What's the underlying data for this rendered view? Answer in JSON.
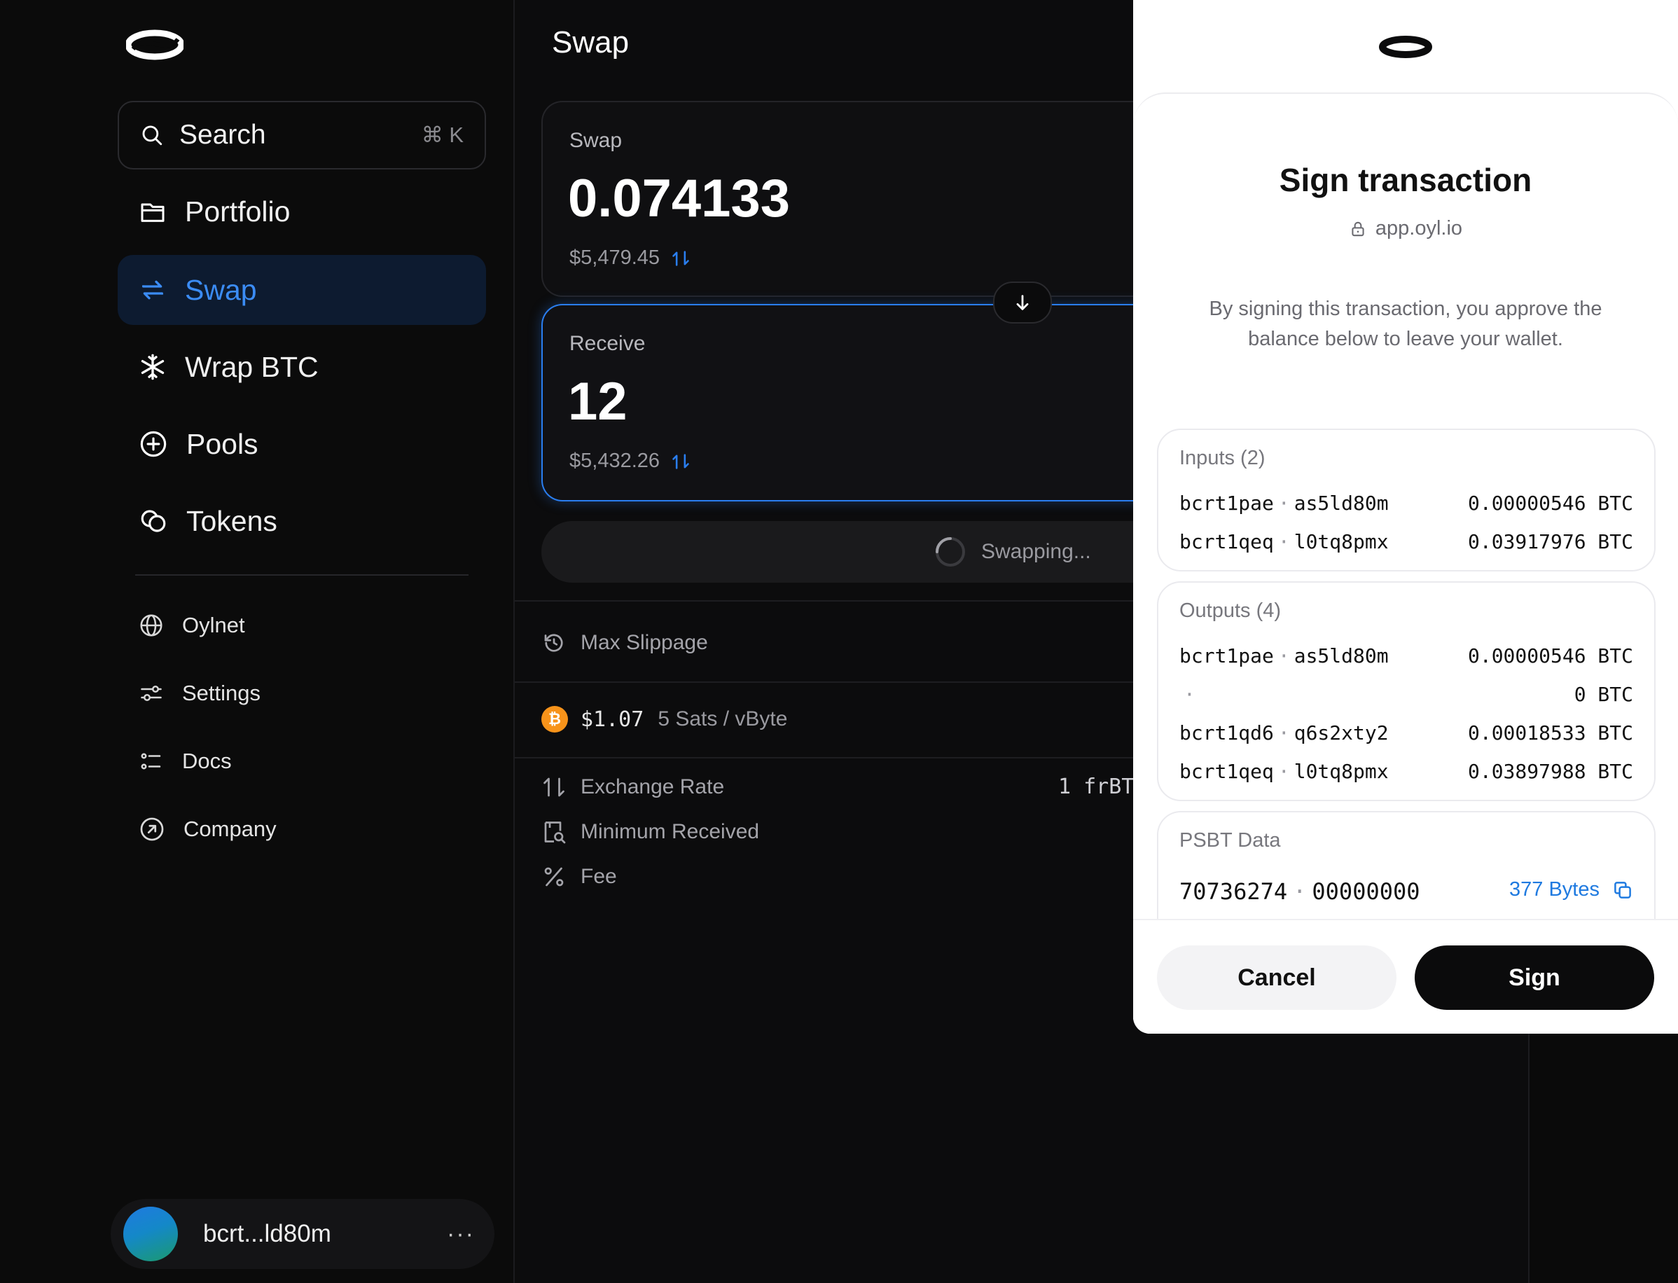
{
  "sidebar": {
    "search_label": "Search",
    "search_shortcut": "⌘ K",
    "nav": [
      {
        "label": "Portfolio",
        "icon": "wallet-icon"
      },
      {
        "label": "Swap",
        "icon": "swap-arrows-icon",
        "active": true
      },
      {
        "label": "Wrap BTC",
        "icon": "snowflake-icon"
      },
      {
        "label": "Pools",
        "icon": "plus-circle-icon"
      },
      {
        "label": "Tokens",
        "icon": "coins-icon"
      }
    ],
    "secondary": [
      {
        "label": "Oylnet",
        "icon": "globe-icon"
      },
      {
        "label": "Settings",
        "icon": "sliders-icon"
      },
      {
        "label": "Docs",
        "icon": "list-icon"
      },
      {
        "label": "Company",
        "icon": "arrow-up-right-circle-icon"
      }
    ],
    "wallet": {
      "address": "bcrt...ld80m",
      "more": "···"
    }
  },
  "main": {
    "title": "Swap",
    "swap": {
      "title": "Swap",
      "amount": "0.074133",
      "usd": "$5,479.45"
    },
    "receive": {
      "title": "Receive",
      "amount": "12",
      "usd": "$5,432.26"
    },
    "status": "Swapping...",
    "max_slippage_label": "Max Slippage",
    "network_fee": {
      "usd": "$1.07",
      "rate": "5 Sats / vByte",
      "coin_glyph": "₿"
    },
    "exchange_rate_label": "Exchange Rate",
    "exchange_rate_value": "1 frBT",
    "minimum_received_label": "Minimum Received",
    "fee_label": "Fee"
  },
  "modal": {
    "title": "Sign transaction",
    "origin": "app.oyl.io",
    "description": "By signing this transaction, you approve the balance below to leave your wallet.",
    "inputs": {
      "header": "Inputs (2)",
      "rows": [
        {
          "a": "bcrt1pae",
          "b": "as5ld80m",
          "value": "0.00000546 BTC"
        },
        {
          "a": "bcrt1qeq",
          "b": "l0tq8pmx",
          "value": "0.03917976 BTC"
        }
      ]
    },
    "outputs": {
      "header": "Outputs (4)",
      "rows": [
        {
          "a": "bcrt1pae",
          "b": "as5ld80m",
          "value": "0.00000546 BTC"
        },
        {
          "a": "",
          "b": "",
          "value": "0 BTC"
        },
        {
          "a": "bcrt1qd6",
          "b": "q6s2xty2",
          "value": "0.00018533 BTC"
        },
        {
          "a": "bcrt1qeq",
          "b": "l0tq8pmx",
          "value": "0.03897988 BTC"
        }
      ]
    },
    "psbt": {
      "header": "PSBT Data",
      "hex_a": "70736274",
      "hex_b": "00000000",
      "size": "377 Bytes"
    },
    "cancel_label": "Cancel",
    "sign_label": "Sign"
  },
  "colors": {
    "accent": "#2a7ef0",
    "btc": "#f7931a",
    "background": "#0a0a0a"
  }
}
